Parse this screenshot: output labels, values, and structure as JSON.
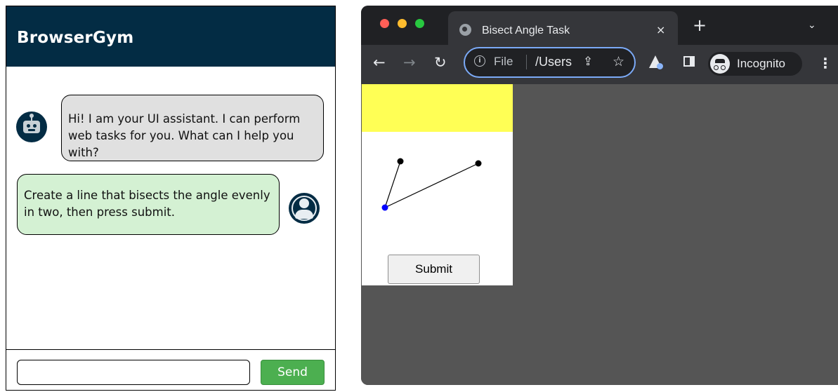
{
  "chat": {
    "title": "BrowserGym",
    "messages": [
      {
        "role": "assistant",
        "avatar_icon": "robot-icon",
        "text": "Hi! I am your UI assistant. I can perform web tasks for you. What can I help you with?"
      },
      {
        "role": "user",
        "avatar_icon": "user-icon",
        "text": "Create a line that bisects the angle evenly in two, then press submit."
      }
    ],
    "input": {
      "value": "",
      "placeholder": ""
    },
    "send_label": "Send"
  },
  "browser": {
    "tab": {
      "title": "Bisect Angle Task",
      "favicon": "globe-icon",
      "close_label": "×"
    },
    "new_tab_label": "+",
    "tab_menu_label": "⌄",
    "nav": {
      "back": "←",
      "forward": "→",
      "reload": "↻"
    },
    "omnibox": {
      "scheme_label": "File",
      "url": "/Users",
      "info_icon": "info-icon",
      "share_icon": "share-icon",
      "star_icon": "star-icon"
    },
    "incognito_label": "Incognito",
    "menu_label": "⋮"
  },
  "task": {
    "submit_label": "Submit",
    "angle": {
      "vertex_color": "#0000ff",
      "point_color": "#000000",
      "line_color": "#000000"
    }
  },
  "colors": {
    "chat_header": "#032c44",
    "bot_bubble": "#e0e0e0",
    "user_bubble": "#d4f1d3",
    "send_button": "#4caf50",
    "query_bar": "#ffff55",
    "browser_viewport": "#555555"
  }
}
